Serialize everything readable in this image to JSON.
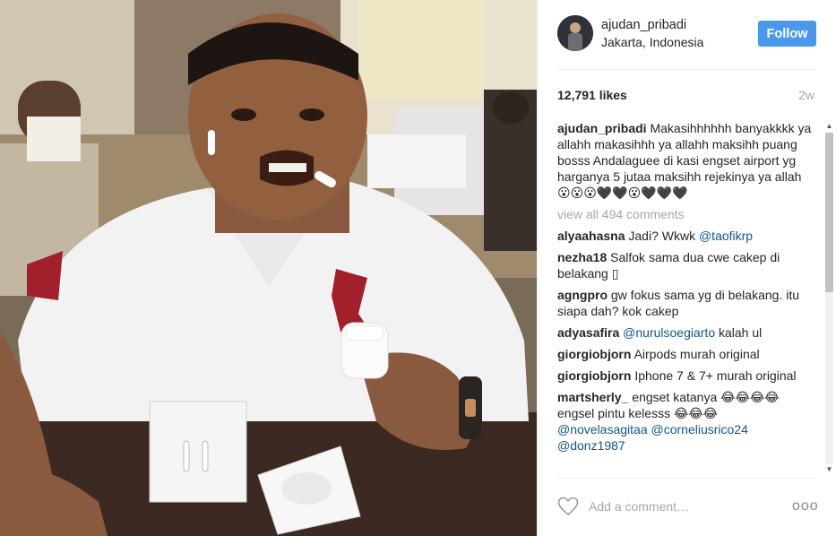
{
  "post": {
    "username": "ajudan_pribadi",
    "location": "Jakarta, Indonesia",
    "follow_label": "Follow",
    "likes": "12,791 likes",
    "time_ago": "2w"
  },
  "caption": {
    "user": "ajudan_pribadi",
    "text": "Makasihhhhhh banyakkkk ya allahh makasihhh ya allahh maksihh puang bosss Andalaguee di kasi engset airport yg harganya 5 jutaa maksihh rejekinya ya allah 😮😮😮🖤🖤😮🖤🖤🖤"
  },
  "view_all_comments": "view all 494 comments",
  "comments": [
    {
      "user": "alyaahasna",
      "text": "Jadi? Wkwk ",
      "mention": "@taofikrp"
    },
    {
      "user": "nezha18",
      "text": "Salfok sama dua cwe cakep di belakang ▯"
    },
    {
      "user": "agngpro",
      "text": "gw fokus sama yg di belakang. itu siapa dah? kok cakep"
    },
    {
      "user": "adyasafira",
      "mention": "@nurulsoegiarto",
      "text_after": " kalah ul"
    },
    {
      "user": "giorgiobjorn",
      "text": "Airpods murah original"
    },
    {
      "user": "giorgiobjorn",
      "text": "Iphone 7 & 7+ murah original"
    },
    {
      "user": "martsherly_",
      "text": "engset katanya 😂😂😂😂 engsel pintu kelesss 😂😂😂",
      "mentions": [
        "@novelasagitaa",
        "@corneliusrico24",
        "@donz1987"
      ]
    }
  ],
  "add_comment": {
    "placeholder": "Add a comment…",
    "more_label": "ooo"
  },
  "icons": {
    "heart": "heart-outline-icon",
    "more": "more-options-icon"
  },
  "colors": {
    "follow_button": "#4a98e9",
    "mention": "#125688",
    "muted": "#a5a7aa"
  }
}
